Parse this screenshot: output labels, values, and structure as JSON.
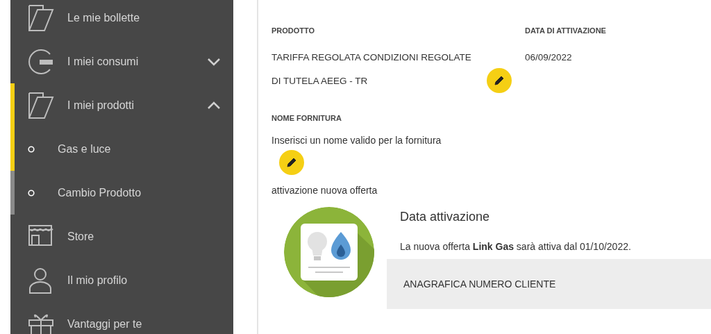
{
  "sidebar": {
    "items": [
      {
        "kind": "link",
        "label": "Le mie bollette",
        "selected": false
      },
      {
        "kind": "group",
        "label": "I miei consumi",
        "selected": false,
        "expanded": false
      },
      {
        "kind": "group",
        "label": "I miei prodotti",
        "selected": true,
        "expanded": true,
        "children": [
          {
            "label": "Gas e luce",
            "selected": true
          },
          {
            "label": "Cambio Prodotto",
            "selected": false
          }
        ]
      },
      {
        "kind": "link",
        "label": "Store",
        "selected": false
      },
      {
        "kind": "link",
        "label": "Il mio profilo",
        "selected": false
      },
      {
        "kind": "link",
        "label": "Vantaggi per te",
        "selected": false
      }
    ]
  },
  "product": {
    "fields": [
      {
        "label": "PRODOTTO",
        "value": "TARIFFA REGOLATA CONDIZIONI REGOLATE DI TUTELA AEEG - TR",
        "editable": true
      },
      {
        "label": "DATA DI ATTIVAZIONE",
        "value": "06/09/2022",
        "editable": false
      }
    ]
  },
  "supply_name": {
    "label": "NOME FORNITURA",
    "value": "Inserisci un nome valido per la fornitura",
    "editable": true
  },
  "note": "attivazione nuova offerta",
  "activation": {
    "title": "Data attivazione",
    "message": "La nuova offerta **Link Gas** sarà attiva dal 01/10/2022."
  },
  "section": {
    "title": "ANAGRAFICA NUMERO CLIENTE"
  }
}
